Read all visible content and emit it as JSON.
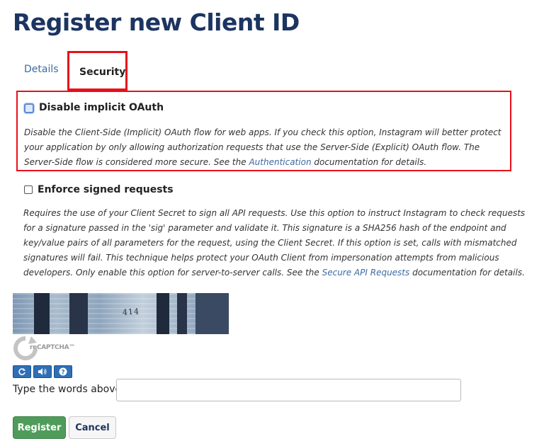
{
  "page": {
    "title": "Register new Client ID"
  },
  "tabs": [
    {
      "label": "Details",
      "active": false
    },
    {
      "label": "Security",
      "active": true
    }
  ],
  "disable_implicit": {
    "label": "Disable implicit OAuth",
    "checked": false,
    "desc_before": "Disable the Client-Side (Implicit) OAuth flow for web apps. If you check this option, Instagram will better protect your application by only allowing authorization requests that use the Server-Side (Explicit) OAuth flow. The Server-Side flow is considered more secure. See the ",
    "link": "Authentication",
    "desc_after": " documentation for details."
  },
  "enforce_signed": {
    "label": "Enforce signed requests",
    "checked": false,
    "desc_before": "Requires the use of your Client Secret to sign all API requests. Use this option to instruct Instagram to check requests for a signature passed in the 'sig' parameter and validate it. This signature is a SHA256 hash of the endpoint and key/value pairs of all parameters for the request, using the Client Secret. If this option is set, calls with mismatched signatures will fail. This technique helps protect your OAuth Client from impersonation attempts from malicious developers. Only enable this option for server-to-server calls. See the ",
    "link": "Secure API Requests",
    "desc_after": " documentation for details."
  },
  "captcha": {
    "image_text": "414",
    "logo_text": "reCAPTCHA™",
    "input_label": "Type the words above:",
    "input_value": "",
    "input_placeholder": "",
    "buttons": [
      "refresh-icon",
      "audio-icon",
      "help-icon"
    ]
  },
  "actions": {
    "register_label": "Register",
    "cancel_label": "Cancel"
  },
  "colors": {
    "title": "#1c3460",
    "link": "#3d6aa0",
    "highlight": "#e8101b",
    "register_bg": "#4f9c5a",
    "captcha_btn": "#2f6fb7"
  }
}
